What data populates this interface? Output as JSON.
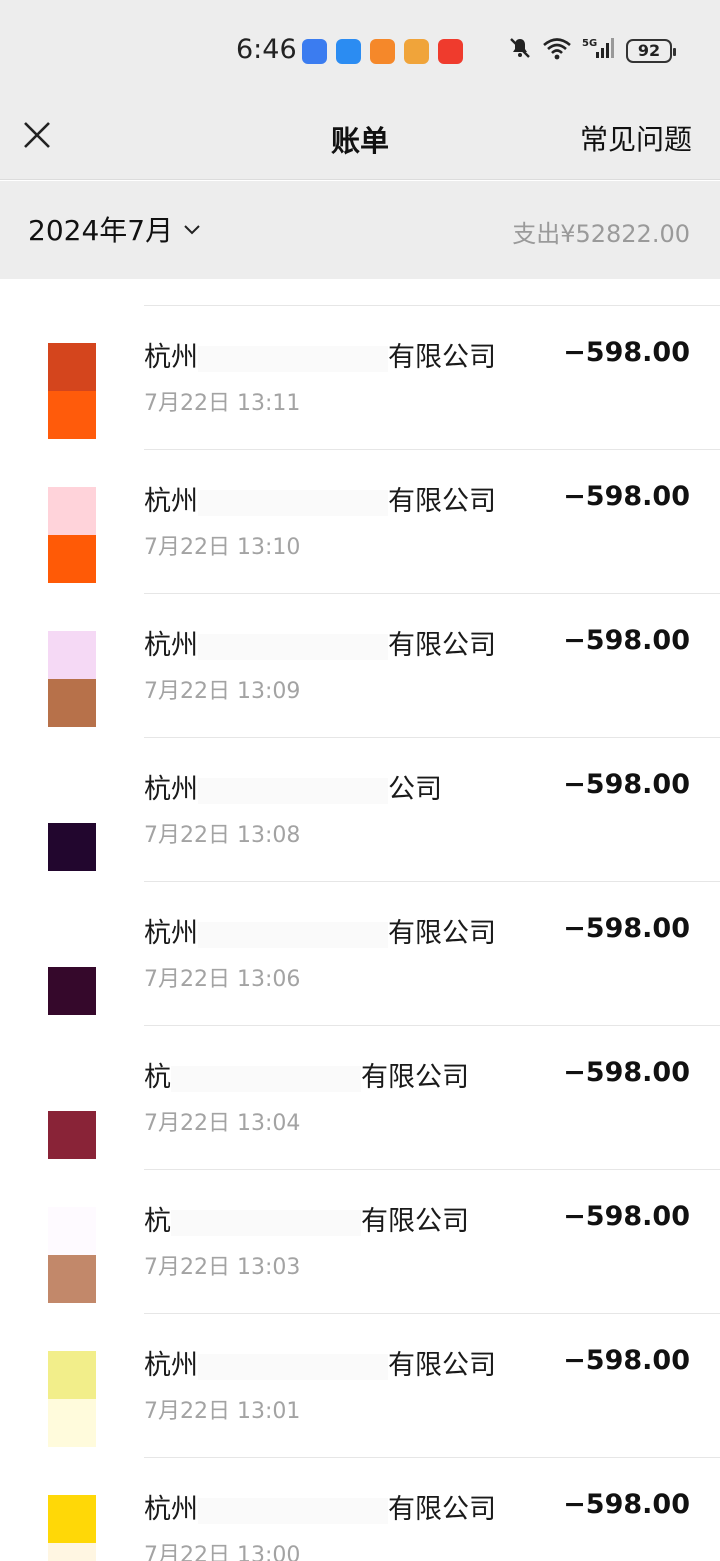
{
  "status_bar": {
    "time": "6:46",
    "apps": [
      {
        "icon": "voice-assistant-app-icon",
        "color": "#3b7cf0"
      },
      {
        "icon": "cloud-app-icon",
        "color": "#2b8cf2"
      },
      {
        "icon": "video-player-app-icon",
        "color": "#f5882a"
      },
      {
        "icon": "notes-app-icon",
        "color": "#f0a43a"
      },
      {
        "icon": "taobao-app-icon",
        "color": "#ef3b2d"
      }
    ],
    "battery": "92"
  },
  "nav": {
    "title": "账单",
    "faq": "常见问题"
  },
  "filter": {
    "month": "2024年7月",
    "total": "支出¥52822.00"
  },
  "bills": [
    {
      "merchant_prefix": "杭州",
      "merchant_suffix": "有限公司",
      "time": "7月22日 13:11",
      "amount": "−598.00",
      "avatar_colors": [
        "#d4451d",
        "#ff5b0b"
      ]
    },
    {
      "merchant_prefix": "杭州",
      "merchant_suffix": "有限公司",
      "time": "7月22日 13:10",
      "amount": "−598.00",
      "avatar_colors": [
        "#ffd3da",
        "#ff5a06"
      ]
    },
    {
      "merchant_prefix": "杭州",
      "merchant_suffix": "有限公司",
      "time": "7月22日 13:09",
      "amount": "−598.00",
      "avatar_colors": [
        "#f5d9f5",
        "#b7714a"
      ]
    },
    {
      "merchant_prefix": "杭州",
      "merchant_suffix": "公司",
      "time": "7月22日 13:08",
      "amount": "−598.00",
      "avatar_colors": [
        "#ffffff",
        "#22062e"
      ]
    },
    {
      "merchant_prefix": "杭州",
      "merchant_suffix": "有限公司",
      "time": "7月22日 13:06",
      "amount": "−598.00",
      "avatar_colors": [
        "#ffffff",
        "#35082b"
      ]
    },
    {
      "merchant_prefix": "杭",
      "merchant_suffix": "有限公司",
      "time": "7月22日 13:04",
      "amount": "−598.00",
      "avatar_colors": [
        "#ffffff",
        "#892337"
      ]
    },
    {
      "merchant_prefix": "杭",
      "merchant_suffix": "有限公司",
      "time": "7月22日 13:03",
      "amount": "−598.00",
      "avatar_colors": [
        "#fefaff",
        "#c2886a"
      ]
    },
    {
      "merchant_prefix": "杭州",
      "merchant_suffix": "有限公司",
      "time": "7月22日 13:01",
      "amount": "−598.00",
      "avatar_colors": [
        "#f2ee8a",
        "#fffbdc"
      ]
    },
    {
      "merchant_prefix": "杭州",
      "merchant_suffix": "有限公司",
      "time": "7月22日 13:00",
      "amount": "−598.00",
      "avatar_colors": [
        "#ffd807",
        "#fff6e2"
      ]
    }
  ]
}
